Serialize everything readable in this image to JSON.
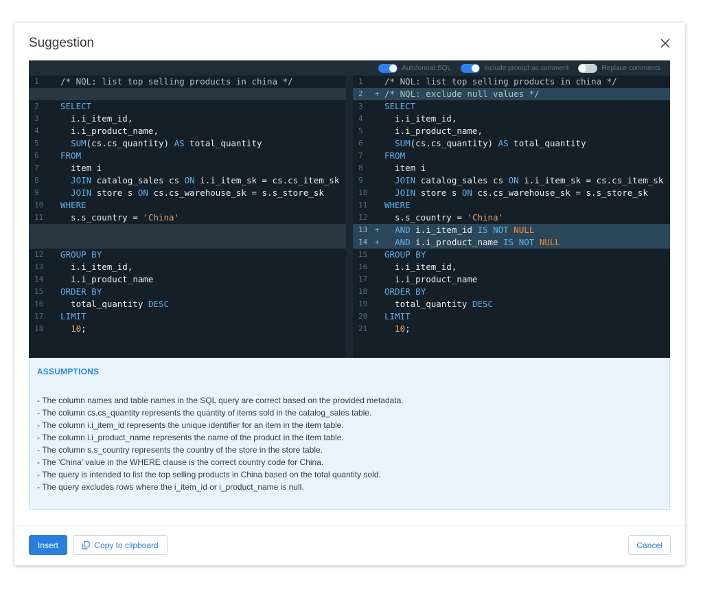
{
  "dialog": {
    "title": "Suggestion",
    "close_icon": "close-icon"
  },
  "toolbar": {
    "toggles": [
      {
        "label": "Autoformat SQL",
        "on": true
      },
      {
        "label": "Include prompt as comment",
        "on": true
      },
      {
        "label": "Replace comments",
        "on": false
      }
    ]
  },
  "diff": {
    "left": [
      {
        "n": "1",
        "text": "/* NQL: list top selling products in china */"
      },
      {
        "pad": true
      },
      {
        "n": "2",
        "text": "SELECT"
      },
      {
        "n": "3",
        "text": "  i.i_item_id,"
      },
      {
        "n": "4",
        "text": "  i.i_product_name,"
      },
      {
        "n": "5",
        "text": "  SUM(cs.cs_quantity) AS total_quantity"
      },
      {
        "n": "6",
        "text": "FROM"
      },
      {
        "n": "7",
        "text": "  item i"
      },
      {
        "n": "8",
        "text": "  JOIN catalog_sales cs ON i.i_item_sk = cs.cs_item_sk"
      },
      {
        "n": "9",
        "text": "  JOIN store s ON cs.cs_warehouse_sk = s.s_store_sk"
      },
      {
        "n": "10",
        "text": "WHERE"
      },
      {
        "n": "11",
        "text": "  s.s_country = 'China'"
      },
      {
        "pad": true
      },
      {
        "pad": true
      },
      {
        "n": "12",
        "text": "GROUP BY"
      },
      {
        "n": "13",
        "text": "  i.i_item_id,"
      },
      {
        "n": "14",
        "text": "  i.i_product_name"
      },
      {
        "n": "15",
        "text": "ORDER BY"
      },
      {
        "n": "16",
        "text": "  total_quantity DESC"
      },
      {
        "n": "17",
        "text": "LIMIT"
      },
      {
        "n": "18",
        "text": "  10;"
      }
    ],
    "right": [
      {
        "n": "1",
        "text": "/* NQL: list top selling products in china */"
      },
      {
        "n": "2",
        "text": "/* NQL: exclude null values */",
        "added": true
      },
      {
        "n": "3",
        "text": "SELECT"
      },
      {
        "n": "4",
        "text": "  i.i_item_id,"
      },
      {
        "n": "5",
        "text": "  i.i_product_name,"
      },
      {
        "n": "6",
        "text": "  SUM(cs.cs_quantity) AS total_quantity"
      },
      {
        "n": "7",
        "text": "FROM"
      },
      {
        "n": "8",
        "text": "  item i"
      },
      {
        "n": "9",
        "text": "  JOIN catalog_sales cs ON i.i_item_sk = cs.cs_item_sk"
      },
      {
        "n": "10",
        "text": "  JOIN store s ON cs.cs_warehouse_sk = s.s_store_sk"
      },
      {
        "n": "11",
        "text": "WHERE"
      },
      {
        "n": "12",
        "text": "  s.s_country = 'China'"
      },
      {
        "n": "13",
        "text": "  AND i.i_item_id IS NOT NULL",
        "added": true
      },
      {
        "n": "14",
        "text": "  AND i.i_product_name IS NOT NULL",
        "added": true
      },
      {
        "n": "15",
        "text": "GROUP BY"
      },
      {
        "n": "16",
        "text": "  i.i_item_id,"
      },
      {
        "n": "17",
        "text": "  i.i_product_name"
      },
      {
        "n": "18",
        "text": "ORDER BY"
      },
      {
        "n": "19",
        "text": "  total_quantity DESC"
      },
      {
        "n": "20",
        "text": "LIMIT"
      },
      {
        "n": "21",
        "text": "  10;"
      }
    ]
  },
  "assumptions": {
    "heading": "ASSUMPTIONS",
    "items": [
      "- The column names and table names in the SQL query are correct based on the provided metadata.",
      "- The column cs.cs_quantity represents the quantity of items sold in the catalog_sales table.",
      "- The column i.i_item_id represents the unique identifier for an item in the item table.",
      "- The column i.i_product_name represents the name of the product in the item table.",
      "- The column s.s_country represents the country of the store in the store table.",
      "- The 'China' value in the WHERE clause is the correct country code for China.",
      "- The query is intended to list the top selling products in China based on the total quantity sold.",
      "- The query excludes rows where the i_item_id or i_product_name is null."
    ]
  },
  "footer": {
    "insert_label": "Insert",
    "copy_label": "Copy to clipboard",
    "copy_icon": "copy-icon",
    "cancel_label": "Cancel"
  },
  "colors": {
    "primary": "#2a7fde",
    "editor_bg": "#141f28",
    "added_bg": "#2b4658",
    "keyword": "#5fb1e8",
    "string": "#e3a16b"
  }
}
